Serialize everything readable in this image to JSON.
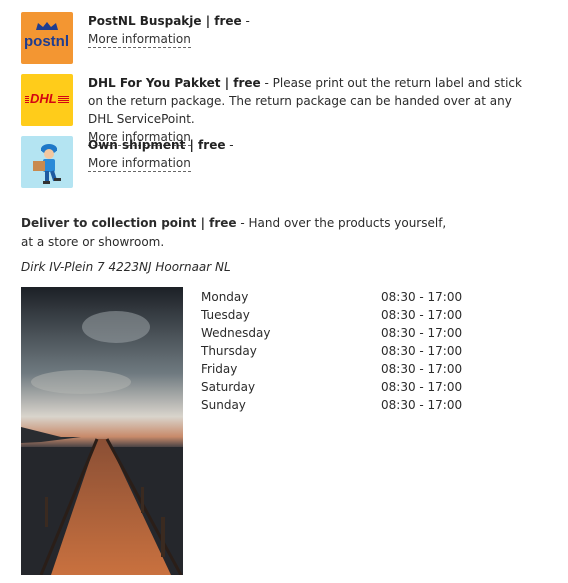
{
  "shipping_options": [
    {
      "icon": "postnl-logo",
      "name": "PostNL Buspakje | free",
      "suffix": " -",
      "description": "",
      "link": "More information"
    },
    {
      "icon": "dhl-logo",
      "name": "DHL For You Pakket | free",
      "suffix": " - ",
      "description": "Please print out the return label and stick on the return package. The return package can be handed over at any DHL ServicePoint.",
      "link": "More information"
    },
    {
      "icon": "courier-icon",
      "name": "Own shipment | free",
      "suffix": " -",
      "description": "",
      "link": "More information"
    }
  ],
  "logos": {
    "postnl_text": "postnl"
  },
  "collection": {
    "title": "Deliver to collection point | free",
    "description": " - Hand over the products yourself, at a store or showroom.",
    "address": "Dirk IV-Plein 7 4223NJ Hoornaar NL",
    "hours": [
      {
        "day": "Monday",
        "time": "08:30 - 17:00"
      },
      {
        "day": "Tuesday",
        "time": "08:30 - 17:00"
      },
      {
        "day": "Wednesday",
        "time": "08:30 - 17:00"
      },
      {
        "day": "Thursday",
        "time": "08:30 - 17:00"
      },
      {
        "day": "Friday",
        "time": "08:30 - 17:00"
      },
      {
        "day": "Saturday",
        "time": "08:30 - 17:00"
      },
      {
        "day": "Sunday",
        "time": "08:30 - 17:00"
      }
    ]
  },
  "colors": {
    "postnl_bg": "#f39632",
    "dhl_bg": "#ffcc1a",
    "dhl_red": "#d40511",
    "own_bg": "#b4e4f2"
  }
}
